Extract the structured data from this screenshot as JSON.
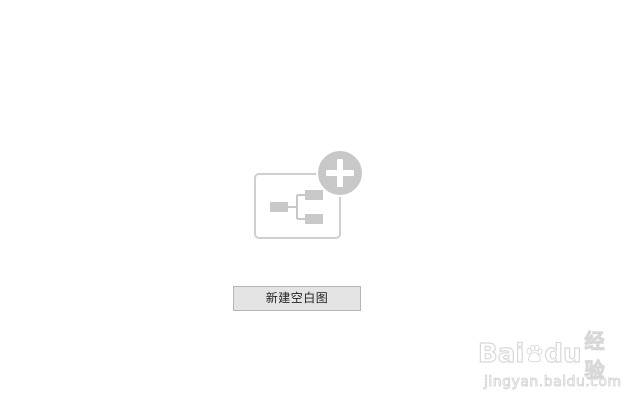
{
  "main": {
    "illustration_icon": "new-mind-map-plus-icon",
    "new_blank_map_label": "新建空白图"
  },
  "watermark": {
    "brand_left": "Bai",
    "brand_right": "du",
    "brand_cn": "经验",
    "url": "jingyan.baidu.com"
  },
  "colors": {
    "illustration_gray": "#c8c8c8",
    "button_bg": "#e4e4e4",
    "button_border": "#b5b5b5",
    "background": "#ffffff"
  }
}
